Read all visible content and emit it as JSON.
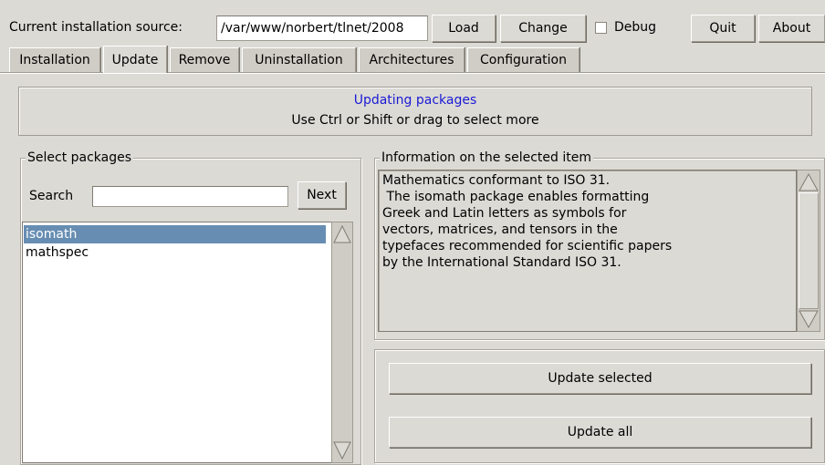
{
  "toolbar": {
    "source_label": "Current installation source:",
    "source_value": "/var/www/norbert/tlnet/2008",
    "load_label": "Load",
    "change_label": "Change",
    "debug_label": "Debug",
    "debug_checked": false,
    "quit_label": "Quit",
    "about_label": "About"
  },
  "tabs": [
    "Installation",
    "Update",
    "Remove",
    "Uninstallation",
    "Architectures",
    "Configuration"
  ],
  "active_tab": "Update",
  "banner": {
    "title": "Updating packages",
    "subtitle": "Use Ctrl or Shift or drag to select more",
    "title_color": "#1a1ad6"
  },
  "packages_panel": {
    "legend": "Select packages",
    "search_label": "Search",
    "search_value": "",
    "next_label": "Next",
    "items": [
      "isomath",
      "mathspec"
    ],
    "selected_item": "isomath",
    "selection_color": "#678db2"
  },
  "info_panel": {
    "legend": "Information on the selected item",
    "lines": [
      "Mathematics conformant to ISO 31.",
      "",
      " The isomath package enables formatting",
      "Greek and Latin letters as symbols for",
      "vectors, matrices, and tensors in the",
      "typefaces recommended for scientific papers",
      "by the International Standard ISO 31."
    ]
  },
  "actions": {
    "update_selected_label": "Update selected",
    "update_all_label": "Update all"
  }
}
